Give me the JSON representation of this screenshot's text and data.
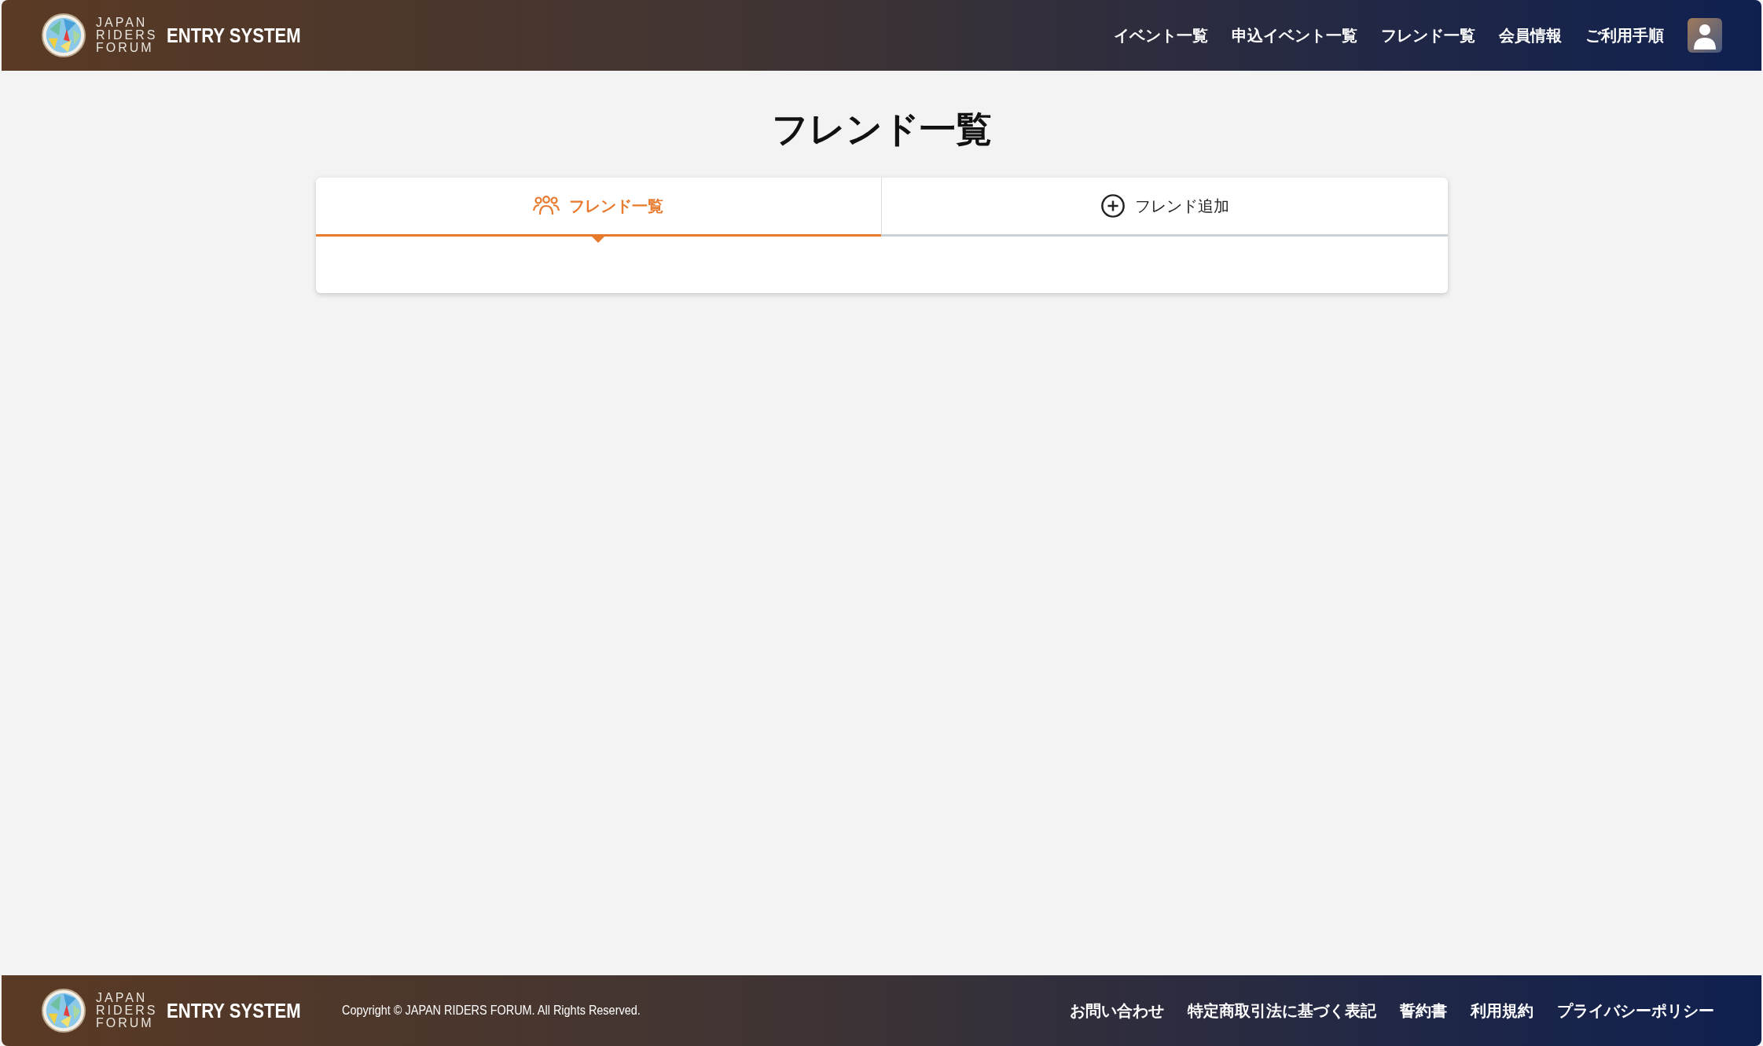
{
  "header": {
    "logo_lines": [
      "JAPAN",
      "RIDERS",
      "FORUM"
    ],
    "system_name": "ENTRY SYSTEM",
    "nav": [
      "イベント一覧",
      "申込イベント一覧",
      "フレンド一覧",
      "会員情報",
      "ご利用手順"
    ]
  },
  "page_title": "フレンド一覧",
  "tabs": [
    {
      "label": "フレンド一覧",
      "kind": "friends",
      "selected": true
    },
    {
      "label": "フレンド追加",
      "kind": "add",
      "selected": false
    }
  ],
  "footer": {
    "logo_lines": [
      "JAPAN",
      "RIDERS",
      "FORUM"
    ],
    "system_name": "ENTRY SYSTEM",
    "copyright": "Copyright © JAPAN RIDERS FORUM. All Rights Reserved.",
    "links": [
      "お問い合わせ",
      "特定商取引法に基づく表記",
      "誓約書",
      "利用規約",
      "プライバシーポリシー"
    ]
  }
}
